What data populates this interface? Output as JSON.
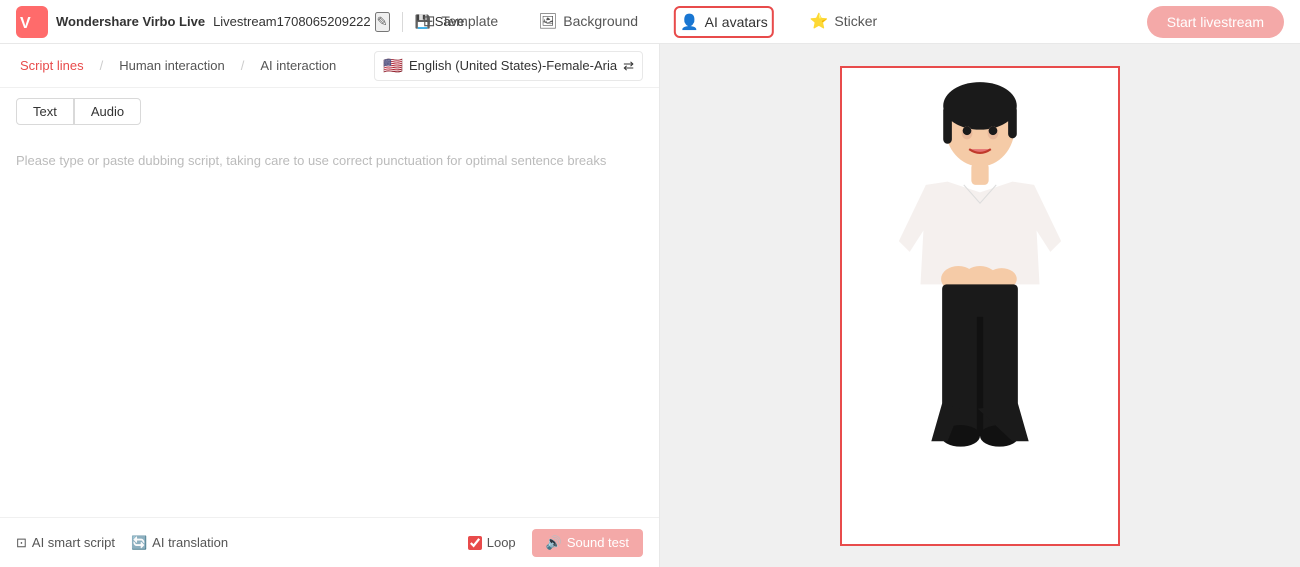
{
  "header": {
    "logo_alt": "Wondershare Virbo Live",
    "session_name": "Livestream1708065209222",
    "edit_icon": "✎",
    "save_label": "Save",
    "save_icon": "💾",
    "nav_tabs": [
      {
        "id": "template",
        "label": "Template",
        "icon": "⊞",
        "active": false
      },
      {
        "id": "background",
        "label": "Background",
        "icon": "🖼",
        "active": false
      },
      {
        "id": "ai-avatars",
        "label": "AI avatars",
        "icon": "👤",
        "active": true
      },
      {
        "id": "sticker",
        "label": "Sticker",
        "icon": "⭐",
        "active": false
      }
    ],
    "start_btn_label": "Start livestream"
  },
  "left_panel": {
    "sub_tabs": [
      {
        "id": "script-lines",
        "label": "Script lines",
        "active": true
      },
      {
        "id": "human-interaction",
        "label": "Human interaction",
        "active": false
      },
      {
        "id": "ai-interaction",
        "label": "AI interaction",
        "active": false
      }
    ],
    "lang_selector": {
      "flag": "🇺🇸",
      "label": "English (United States)-Female-Aria",
      "icon": "⇄"
    },
    "text_audio_tabs": [
      {
        "id": "text",
        "label": "Text",
        "active": true
      },
      {
        "id": "audio",
        "label": "Audio",
        "active": false
      }
    ],
    "placeholder": "Please type or paste dubbing script, taking care to use correct punctuation for optimal sentence breaks",
    "bottom": {
      "ai_smart_script_label": "AI smart script",
      "ai_smart_script_icon": "⊡",
      "ai_translation_label": "AI translation",
      "ai_translation_icon": "🔄",
      "loop_label": "Loop",
      "sound_test_label": "Sound test",
      "sound_test_icon": "🔊"
    }
  },
  "right_panel": {
    "canvas_description": "AI avatar canvas with female presenter"
  }
}
